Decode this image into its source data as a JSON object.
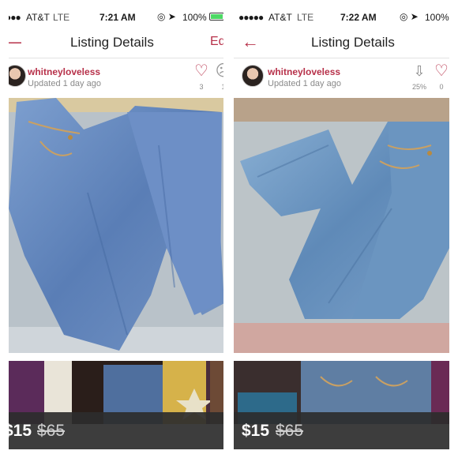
{
  "screens": [
    {
      "status": {
        "signal": "●●● ",
        "carrier": "AT&T",
        "network": "LTE",
        "time": "7:21 AM",
        "battery_pct": "100%",
        "battery_color": "#4cd964"
      },
      "nav": {
        "title": "Listing Details",
        "left_icon": "close-icon",
        "right_label": "Ed"
      },
      "seller": {
        "username": "whitneyloveless",
        "updated": "Updated 1 day ago"
      },
      "likes": {
        "icon": "heart-icon",
        "count": "3"
      },
      "comments": {
        "icon": "comment-icon",
        "count": "1"
      },
      "price": {
        "current": "$15",
        "original": "$65"
      }
    },
    {
      "status": {
        "signal": "●●●●● ",
        "carrier": "AT&T",
        "network": "LTE",
        "time": "7:22 AM",
        "battery_pct": "100%"
      },
      "nav": {
        "title": "Listing Details",
        "left_icon": "back-arrow-icon"
      },
      "seller": {
        "username": "whitneyloveless",
        "updated": "Updated 1 day ago"
      },
      "price_drop": {
        "icon": "down-arrow-icon",
        "percent": "25%"
      },
      "likes": {
        "icon": "heart-icon",
        "count": "0"
      },
      "price": {
        "current": "$15",
        "original": "$65"
      }
    }
  ],
  "colors": {
    "accent": "#b7314a",
    "price_bar": "#2c2c2c"
  }
}
